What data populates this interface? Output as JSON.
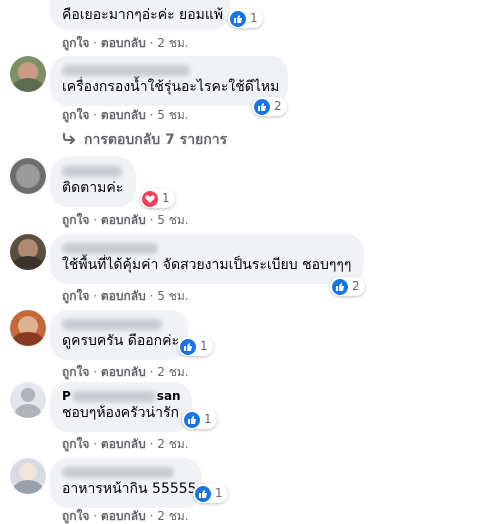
{
  "comments": [
    {
      "text": "คือเยอะมากๆอ่ะค่ะ ยอมแพ้",
      "reaction": {
        "type": "like",
        "count": "1"
      },
      "actions": {
        "like": "ถูกใจ",
        "sep": "·",
        "reply": "ตอบกลับ",
        "time": "2 ชม."
      }
    },
    {
      "text": "เครื่องกรองน้ำใช้รุ่นอะไรคะใช้ดีไหม",
      "reaction": {
        "type": "like",
        "count": "2"
      },
      "actions": {
        "like": "ถูกใจ",
        "sep": "·",
        "reply": "ตอบกลับ",
        "time": "5 ชม."
      },
      "replies_label": "การตอบกลับ 7 รายการ"
    },
    {
      "text": "ติดตามค่ะ",
      "reaction": {
        "type": "love",
        "count": "1"
      },
      "actions": {
        "like": "ถูกใจ",
        "sep": "·",
        "reply": "ตอบกลับ",
        "time": "5 ชม."
      }
    },
    {
      "text": "ใช้พื้นที่ได้คุ้มค่า จัดสวยงามเป็นระเบียบ ชอบๆๆๆ",
      "reaction": {
        "type": "like",
        "count": "2"
      },
      "actions": {
        "like": "ถูกใจ",
        "sep": "·",
        "reply": "ตอบกลับ",
        "time": "5 ชม."
      }
    },
    {
      "text": "ดูครบครัน ดีออกค่ะ",
      "reaction": {
        "type": "like",
        "count": "1"
      },
      "actions": {
        "like": "ถูกใจ",
        "sep": "·",
        "reply": "ตอบกลับ",
        "time": "2 ชม."
      }
    },
    {
      "name_prefix": "P",
      "name_suffix": "san",
      "text": "ชอบๆห้องครัวน่ารัก",
      "reaction": {
        "type": "like",
        "count": "1"
      },
      "actions": {
        "like": "ถูกใจ",
        "sep": "·",
        "reply": "ตอบกลับ",
        "time": "2 ชม."
      }
    },
    {
      "text": "อาหารหน้ากิน 55555",
      "reaction": {
        "type": "like",
        "count": "1"
      },
      "actions": {
        "like": "ถูกใจ",
        "sep": "·",
        "reply": "ตอบกลับ",
        "time": "2 ชม."
      }
    }
  ],
  "colors": {
    "bubble": "#f0f2f5",
    "like": "#1b74e4",
    "love": "#f33e58",
    "secondary_text": "#65676b"
  },
  "icons": {
    "like": "thumbs-up-icon",
    "love": "heart-icon",
    "replies": "reply-arrow-icon"
  }
}
